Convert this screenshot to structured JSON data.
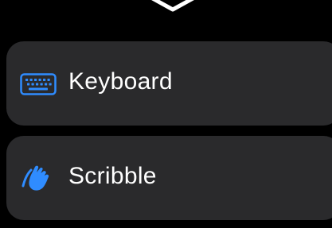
{
  "header": {
    "chevron_icon": "chevron-down-icon"
  },
  "options": [
    {
      "label": "Keyboard",
      "icon": "keyboard-icon"
    },
    {
      "label": "Scribble",
      "icon": "scribble-hand-icon"
    }
  ],
  "colors": {
    "background": "#000000",
    "row_background": "#2a2a2c",
    "label": "#ffffff",
    "icon_accent": "#2f8cff"
  }
}
